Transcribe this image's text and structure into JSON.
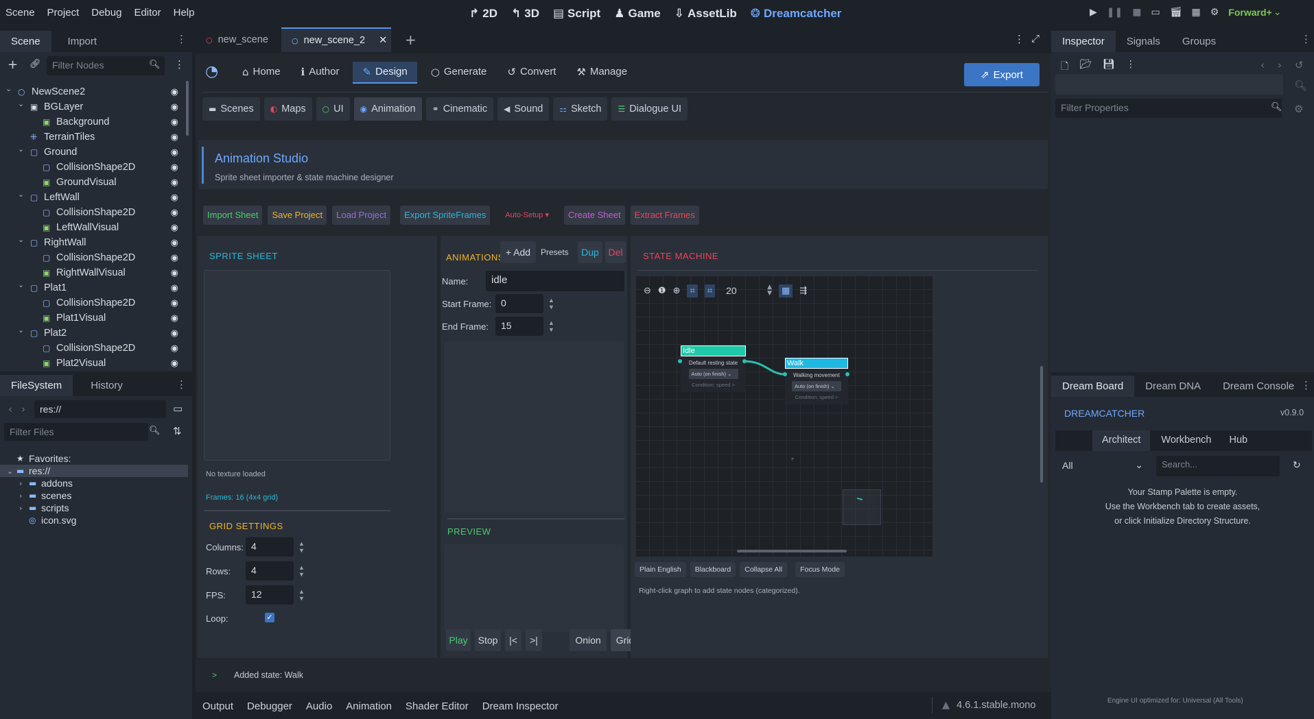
{
  "menu": [
    "Scene",
    "Project",
    "Debug",
    "Editor",
    "Help"
  ],
  "main_screens": [
    {
      "icon": "2d-icon",
      "label": "2D"
    },
    {
      "icon": "3d-icon",
      "label": "3D"
    },
    {
      "icon": "script-icon",
      "label": "Script"
    },
    {
      "icon": "game-icon",
      "label": "Game"
    },
    {
      "icon": "assetlib-icon",
      "label": "AssetLib"
    },
    {
      "icon": "dreamcatcher-icon",
      "label": "Dreamcatcher"
    }
  ],
  "renderer": "Forward+",
  "scene_tabs": {
    "scene": "Scene",
    "import": "Import"
  },
  "filter_nodes_placeholder": "Filter Nodes",
  "tree": [
    {
      "label": "NewScene2",
      "depth": 0,
      "arrow": "⌄",
      "icon": "○",
      "c": "#8fb8ff"
    },
    {
      "label": "BGLayer",
      "depth": 1,
      "arrow": "⌄",
      "icon": "▣",
      "c": "#d8dde4"
    },
    {
      "label": "Background",
      "depth": 2,
      "arrow": "",
      "icon": "▣",
      "c": "#8bd46f"
    },
    {
      "label": "TerrainTiles",
      "depth": 1,
      "arrow": "",
      "icon": "⁜",
      "c": "#8fb8ff"
    },
    {
      "label": "Ground",
      "depth": 1,
      "arrow": "⌄",
      "icon": "▢",
      "c": "#8fb8ff"
    },
    {
      "label": "CollisionShape2D",
      "depth": 2,
      "arrow": "",
      "icon": "▢",
      "c": "#8fb8ff"
    },
    {
      "label": "GroundVisual",
      "depth": 2,
      "arrow": "",
      "icon": "▣",
      "c": "#8bd46f"
    },
    {
      "label": "LeftWall",
      "depth": 1,
      "arrow": "⌄",
      "icon": "▢",
      "c": "#8fb8ff"
    },
    {
      "label": "CollisionShape2D",
      "depth": 2,
      "arrow": "",
      "icon": "▢",
      "c": "#8fb8ff"
    },
    {
      "label": "LeftWallVisual",
      "depth": 2,
      "arrow": "",
      "icon": "▣",
      "c": "#8bd46f"
    },
    {
      "label": "RightWall",
      "depth": 1,
      "arrow": "⌄",
      "icon": "▢",
      "c": "#8fb8ff"
    },
    {
      "label": "CollisionShape2D",
      "depth": 2,
      "arrow": "",
      "icon": "▢",
      "c": "#8fb8ff"
    },
    {
      "label": "RightWallVisual",
      "depth": 2,
      "arrow": "",
      "icon": "▣",
      "c": "#8bd46f"
    },
    {
      "label": "Plat1",
      "depth": 1,
      "arrow": "⌄",
      "icon": "▢",
      "c": "#8fb8ff"
    },
    {
      "label": "CollisionShape2D",
      "depth": 2,
      "arrow": "",
      "icon": "▢",
      "c": "#8fb8ff"
    },
    {
      "label": "Plat1Visual",
      "depth": 2,
      "arrow": "",
      "icon": "▣",
      "c": "#8bd46f"
    },
    {
      "label": "Plat2",
      "depth": 1,
      "arrow": "⌄",
      "icon": "▢",
      "c": "#8fb8ff"
    },
    {
      "label": "CollisionShape2D",
      "depth": 2,
      "arrow": "",
      "icon": "▢",
      "c": "#8fb8ff"
    },
    {
      "label": "Plat2Visual",
      "depth": 2,
      "arrow": "",
      "icon": "▣",
      "c": "#8bd46f"
    }
  ],
  "fs_tabs": {
    "filesystem": "FileSystem",
    "history": "History"
  },
  "fs_path": "res://",
  "filter_files_placeholder": "Filter Files",
  "fs_tree": [
    {
      "label": "Favorites:",
      "depth": 0,
      "icon": "★",
      "arrow": ""
    },
    {
      "label": "res://",
      "depth": 0,
      "icon": "▬",
      "arrow": "⌄"
    },
    {
      "label": "addons",
      "depth": 1,
      "icon": "▬",
      "arrow": "›"
    },
    {
      "label": "scenes",
      "depth": 1,
      "icon": "▬",
      "arrow": "›"
    },
    {
      "label": "scripts",
      "depth": 1,
      "icon": "▬",
      "arrow": "›"
    },
    {
      "label": "icon.svg",
      "depth": 1,
      "icon": "◎",
      "arrow": ""
    }
  ],
  "doc_tabs": [
    "new_scene",
    "new_scene_2"
  ],
  "dc_nav": [
    "Home",
    "Author",
    "Design",
    "Generate",
    "Convert",
    "Manage"
  ],
  "export_label": "Export",
  "design_tabs": [
    "Scenes",
    "Maps",
    "UI",
    "Animation",
    "Cinematic",
    "Sound",
    "Sketch",
    "Dialogue UI"
  ],
  "studio": {
    "title": "Animation Studio",
    "subtitle": "Sprite sheet importer & state machine designer"
  },
  "actions": [
    {
      "label": "Import Sheet",
      "c": "#4ecb71"
    },
    {
      "label": "Save Project",
      "c": "#f0b429"
    },
    {
      "label": "Load Project",
      "c": "#9b6cd8"
    },
    {
      "label": "Export SpriteFrames",
      "c": "#2ab8d8"
    },
    {
      "label": "Auto-Setup ▾",
      "c": "#e8455a"
    },
    {
      "label": "Create Sheet",
      "c": "#c25fd0"
    },
    {
      "label": "Extract Frames",
      "c": "#e8455a"
    }
  ],
  "sprite": {
    "title": "SPRITE SHEET",
    "no_texture": "No texture loaded",
    "frames": "Frames: 16 (4x4 grid)"
  },
  "grid": {
    "title": "GRID SETTINGS",
    "columns_label": "Columns:",
    "columns": "4",
    "rows_label": "Rows:",
    "rows": "4",
    "fps_label": "FPS:",
    "fps": "12",
    "loop_label": "Loop:"
  },
  "anims": {
    "title": "ANIMATIONS",
    "add": "+ Add",
    "presets": "Presets",
    "dup": "Dup",
    "del": "Del",
    "name_label": "Name:",
    "name": "idle",
    "start_label": "Start Frame:",
    "start": "0",
    "end_label": "End Frame:",
    "end": "15"
  },
  "preview": {
    "title": "PREVIEW",
    "play": "Play",
    "stop": "Stop",
    "first": "|<",
    "last": ">|",
    "onion": "Onion",
    "grid": "Grid"
  },
  "sm": {
    "title": "STATE MACHINE",
    "zoom": "20",
    "nodes": [
      {
        "title": "Idle",
        "desc": "Default resting state",
        "mode": "Auto (on finish)",
        "cond": "Condition: speed >"
      },
      {
        "title": "Walk",
        "desc": "Walking movement",
        "mode": "Auto (on finish)",
        "cond": "Condition: speed >"
      }
    ],
    "buttons": [
      "Plain English",
      "Blackboard",
      "Collapse All",
      "Focus Mode"
    ],
    "hint": "Right-click graph to add state nodes (categorized)."
  },
  "log": {
    "prompt": ">",
    "text": "Added state: Walk"
  },
  "bottom_tabs": [
    "Output",
    "Debugger",
    "Audio",
    "Animation",
    "Shader Editor",
    "Dream Inspector"
  ],
  "version": "4.6.1.stable.mono",
  "inspector_tabs": [
    "Inspector",
    "Signals",
    "Groups"
  ],
  "filter_props_placeholder": "Filter Properties",
  "dream_tabs": [
    "Dream Board",
    "Dream DNA",
    "Dream Console"
  ],
  "dream": {
    "title": "DREAMCATCHER",
    "version": "v0.9.0",
    "subtabs": [
      "Architect",
      "Workbench",
      "Hub"
    ],
    "filter": "All",
    "search_placeholder": "Search...",
    "empty1": "Your Stamp Palette is empty.",
    "empty2": "Use the Workbench tab to create assets,",
    "empty3": "or click Initialize Directory Structure.",
    "footer": "Engine UI optimized for: Universal (All Tools)"
  }
}
